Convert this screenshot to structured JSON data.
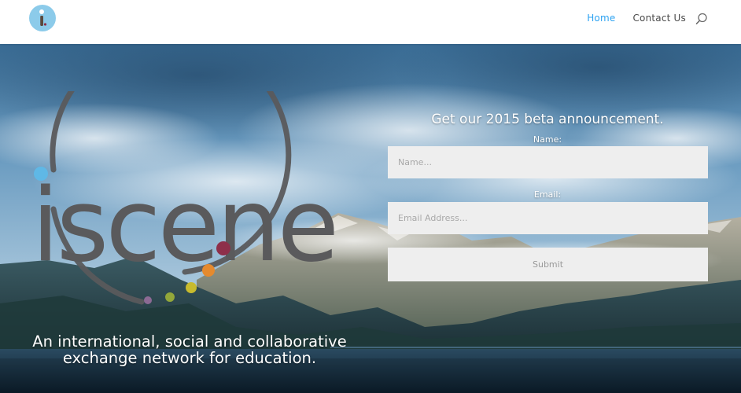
{
  "header": {
    "logo_letter": "i",
    "nav": {
      "home": "Home",
      "contact": "Contact Us"
    },
    "colors": {
      "active_link": "#2ea3f2",
      "link": "#4a4a4a",
      "logo_circle": "#8ccbea"
    }
  },
  "hero": {
    "brand_name": "iscene",
    "tagline_line1": "An international, social and collaborative",
    "tagline_line2": "exchange network for education.",
    "brand_colors": {
      "text": "#5a5a5c",
      "dot_blue": "#5fb8e6",
      "dot_red": "#8e2f4a",
      "dot_orange": "#e58a2e",
      "dot_yellow": "#c8bb2e",
      "dot_green": "#93a73a",
      "dot_purple": "#8c6a94"
    }
  },
  "form": {
    "title": "Get our 2015 beta announcement.",
    "name_label": "Name:",
    "name_placeholder": "Name...",
    "email_label": "Email:",
    "email_placeholder": "Email Address...",
    "submit_label": "Submit"
  }
}
